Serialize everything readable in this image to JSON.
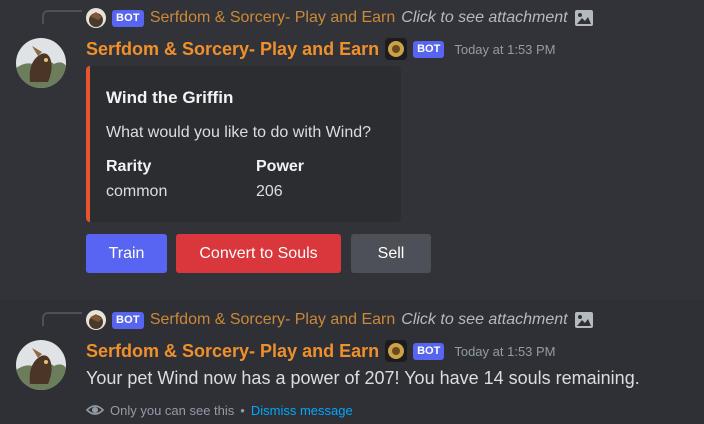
{
  "messages": [
    {
      "reply": {
        "bot_tag": "BOT",
        "author": "Serfdom & Sorcery- Play and Earn",
        "hint": "Click to see attachment"
      },
      "author": "Serfdom & Sorcery- Play and Earn",
      "bot_tag": "BOT",
      "timestamp": "Today at 1:53 PM",
      "embed": {
        "accent_color": "#e8542c",
        "title": "Wind the Griffin",
        "description": "What would you like to do with Wind?",
        "fields": [
          {
            "name": "Rarity",
            "value": "common"
          },
          {
            "name": "Power",
            "value": "206"
          }
        ]
      },
      "buttons": [
        {
          "label": "Train",
          "color": "#5865f2"
        },
        {
          "label": "Convert to Souls",
          "color": "#da373c"
        },
        {
          "label": "Sell",
          "color": "#4e5058"
        }
      ]
    },
    {
      "reply": {
        "bot_tag": "BOT",
        "author": "Serfdom & Sorcery- Play and Earn",
        "hint": "Click to see attachment"
      },
      "author": "Serfdom & Sorcery- Play and Earn",
      "bot_tag": "BOT",
      "timestamp": "Today at 1:53 PM",
      "content": "Your pet Wind now has a power of 207! You have 14 souls remaining.",
      "ephemeral_note": "Only you can see this",
      "separator": "•",
      "dismiss_label": "Dismiss message"
    }
  ],
  "colors": {
    "background": "#313338",
    "author": "#f0902c",
    "bot_tag": "#5865f2",
    "link": "#00a8fc"
  }
}
